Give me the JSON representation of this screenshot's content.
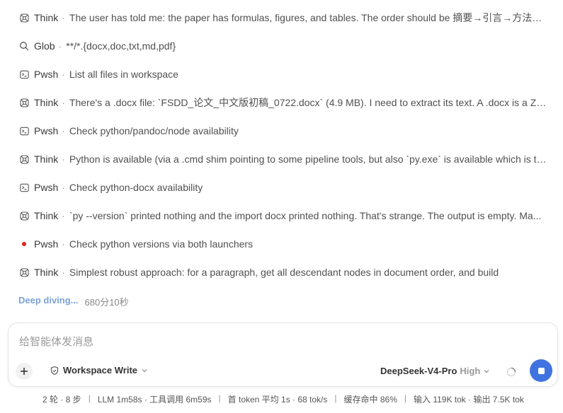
{
  "steps": [
    {
      "icon": "think-icon",
      "tool": "Think",
      "desc": "The user has told me: the paper has formulas, figures, and tables. The order should be 摘要→引言→方法→..."
    },
    {
      "icon": "search-icon",
      "tool": "Glob",
      "desc": "**/*.{docx,doc,txt,md,pdf}"
    },
    {
      "icon": "terminal-icon",
      "tool": "Pwsh",
      "desc": "List all files in workspace"
    },
    {
      "icon": "think-icon",
      "tool": "Think",
      "desc": "There's a .docx file: `FSDD_论文_中文版初稿_0722.docx` (4.9 MB). I need to extract its text. A .docx is a ZIP ar..."
    },
    {
      "icon": "terminal-icon",
      "tool": "Pwsh",
      "desc": "Check python/pandoc/node availability"
    },
    {
      "icon": "think-icon",
      "tool": "Think",
      "desc": "Python is available (via a .cmd shim pointing to some pipeline tools, but also `py.exe` is available which is th..."
    },
    {
      "icon": "terminal-icon",
      "tool": "Pwsh",
      "desc": "Check python-docx availability"
    },
    {
      "icon": "think-icon",
      "tool": "Think",
      "desc": "`py --version` printed nothing and the import docx printed nothing. That's strange. The output is empty. Ma..."
    },
    {
      "icon": "running-dot-icon",
      "tool": "Pwsh",
      "desc": "Check python versions via both launchers"
    },
    {
      "icon": "think-icon",
      "tool": "Think",
      "desc": "Simplest robust approach: for a paragraph, get all descendant nodes in document order, and build"
    }
  ],
  "separator": "·",
  "status": {
    "label": "Deep diving...",
    "elapsed": "680分10秒"
  },
  "composer": {
    "placeholder": "给智能体发消息",
    "workspace_label": "Workspace Write",
    "model_name": "DeepSeek-V4-Pro",
    "model_level": "High"
  },
  "stats": [
    "2 轮 · 8 步",
    "LLM 1m58s · 工具调用 6m59s",
    "首 token 平均 1s · 68 tok/s",
    "缓存命中 86%",
    "输入 119K tok · 输出 7.5K tok"
  ]
}
